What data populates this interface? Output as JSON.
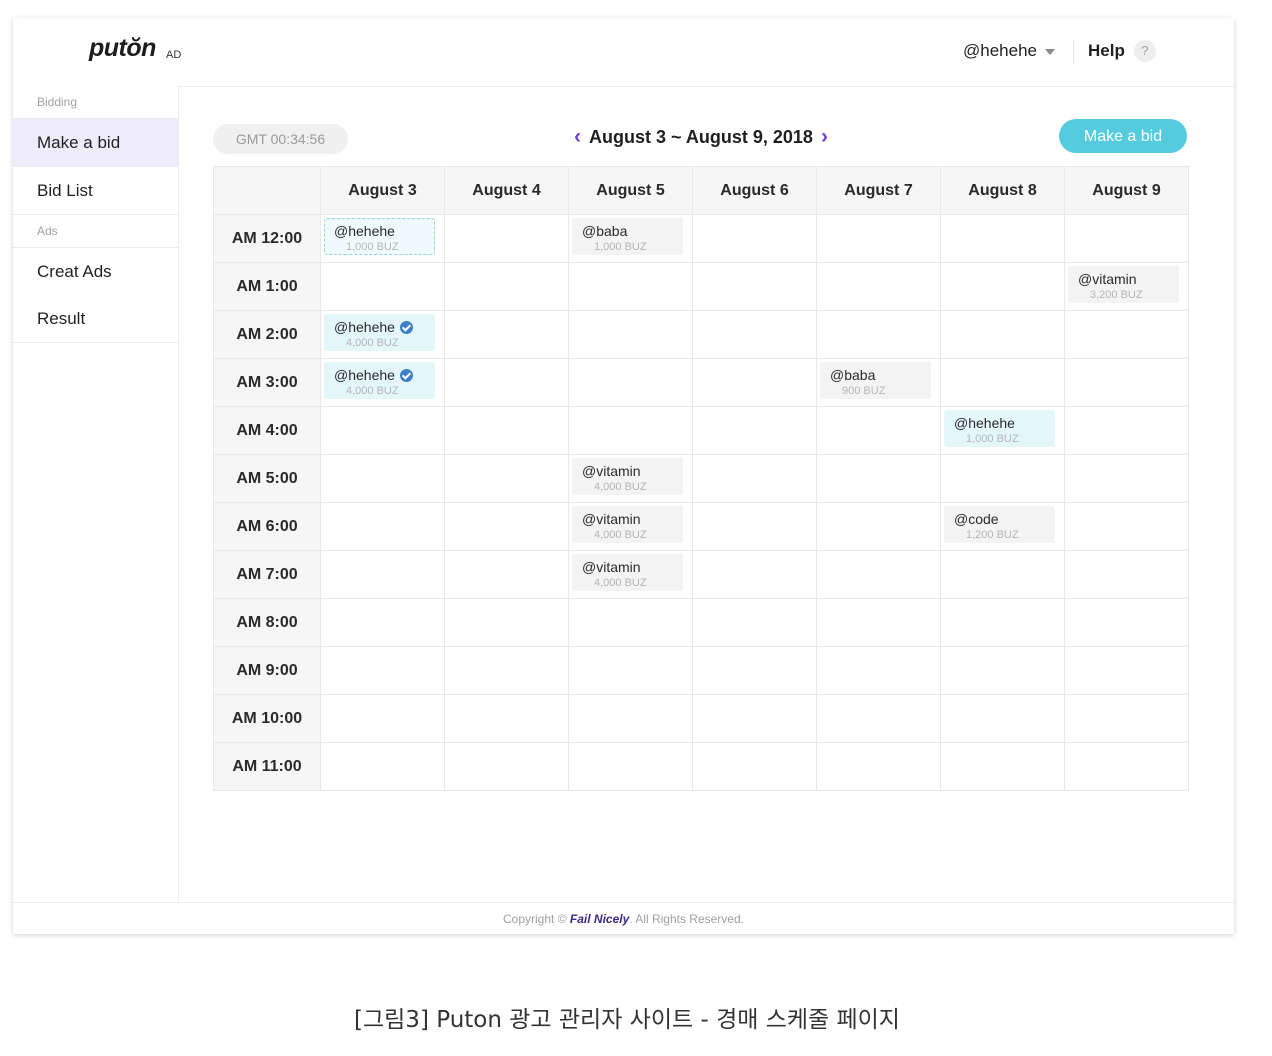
{
  "header": {
    "logo_text": "putŏn",
    "logo_sub": "AD",
    "user": "@hehehe",
    "help_label": "Help",
    "help_icon_glyph": "?"
  },
  "sidebar": {
    "sections": [
      {
        "title": "Bidding",
        "items": [
          {
            "label": "Make a bid",
            "active": true
          },
          {
            "label": "Bid List"
          }
        ]
      },
      {
        "title": "Ads",
        "items": [
          {
            "label": "Creat Ads"
          },
          {
            "label": "Result"
          }
        ]
      }
    ]
  },
  "toolbar": {
    "gmt": "GMT 00:34:56",
    "week_range": "August 3 ~ August 9, 2018",
    "prev_arrow": "‹",
    "next_arrow": "›",
    "make_bid_label": "Make a bid"
  },
  "schedule": {
    "days": [
      "August 3",
      "August 4",
      "August 5",
      "August 6",
      "August 7",
      "August 8",
      "August 9"
    ],
    "times": [
      "AM 12:00",
      "AM 1:00",
      "AM 2:00",
      "AM 3:00",
      "AM 4:00",
      "AM 5:00",
      "AM 6:00",
      "AM 7:00",
      "AM 8:00",
      "AM 9:00",
      "AM 10:00",
      "AM 11:00"
    ],
    "bids": [
      {
        "row": 0,
        "col": 0,
        "user": "@hehehe",
        "amount": "1,000 BUZ",
        "style": "dashed",
        "verified": false
      },
      {
        "row": 0,
        "col": 2,
        "user": "@baba",
        "amount": "1,000 BUZ",
        "style": "gray",
        "verified": false
      },
      {
        "row": 1,
        "col": 6,
        "user": "@vitamin",
        "amount": "3,200 BUZ",
        "style": "gray",
        "verified": false
      },
      {
        "row": 2,
        "col": 0,
        "user": "@hehehe",
        "amount": "4,000 BUZ",
        "style": "teal",
        "verified": true
      },
      {
        "row": 3,
        "col": 0,
        "user": "@hehehe",
        "amount": "4,000 BUZ",
        "style": "teal",
        "verified": true
      },
      {
        "row": 3,
        "col": 4,
        "user": "@baba",
        "amount": "900 BUZ",
        "style": "gray",
        "verified": false
      },
      {
        "row": 4,
        "col": 5,
        "user": "@hehehe",
        "amount": "1,000 BUZ",
        "style": "teal",
        "verified": false
      },
      {
        "row": 5,
        "col": 2,
        "user": "@vitamin",
        "amount": "4,000 BUZ",
        "style": "gray",
        "verified": false
      },
      {
        "row": 6,
        "col": 2,
        "user": "@vitamin",
        "amount": "4,000 BUZ",
        "style": "gray",
        "verified": false
      },
      {
        "row": 6,
        "col": 5,
        "user": "@code",
        "amount": "1,200 BUZ",
        "style": "gray",
        "verified": false
      },
      {
        "row": 7,
        "col": 2,
        "user": "@vitamin",
        "amount": "4,000 BUZ",
        "style": "gray",
        "verified": false
      }
    ]
  },
  "footer": {
    "prefix": "Copyright ©",
    "brand": "Fail Nicely",
    "suffix": ". All Rights Reserved."
  },
  "caption": "[그림3] Puton 광고 관리자 사이트 - 경매 스케줄 페이지",
  "colors": {
    "accent_teal": "#54ccdd",
    "accent_purple": "#6c3fd1",
    "active_item": "#eeebfb",
    "brand_dark": "#3b2a83"
  }
}
